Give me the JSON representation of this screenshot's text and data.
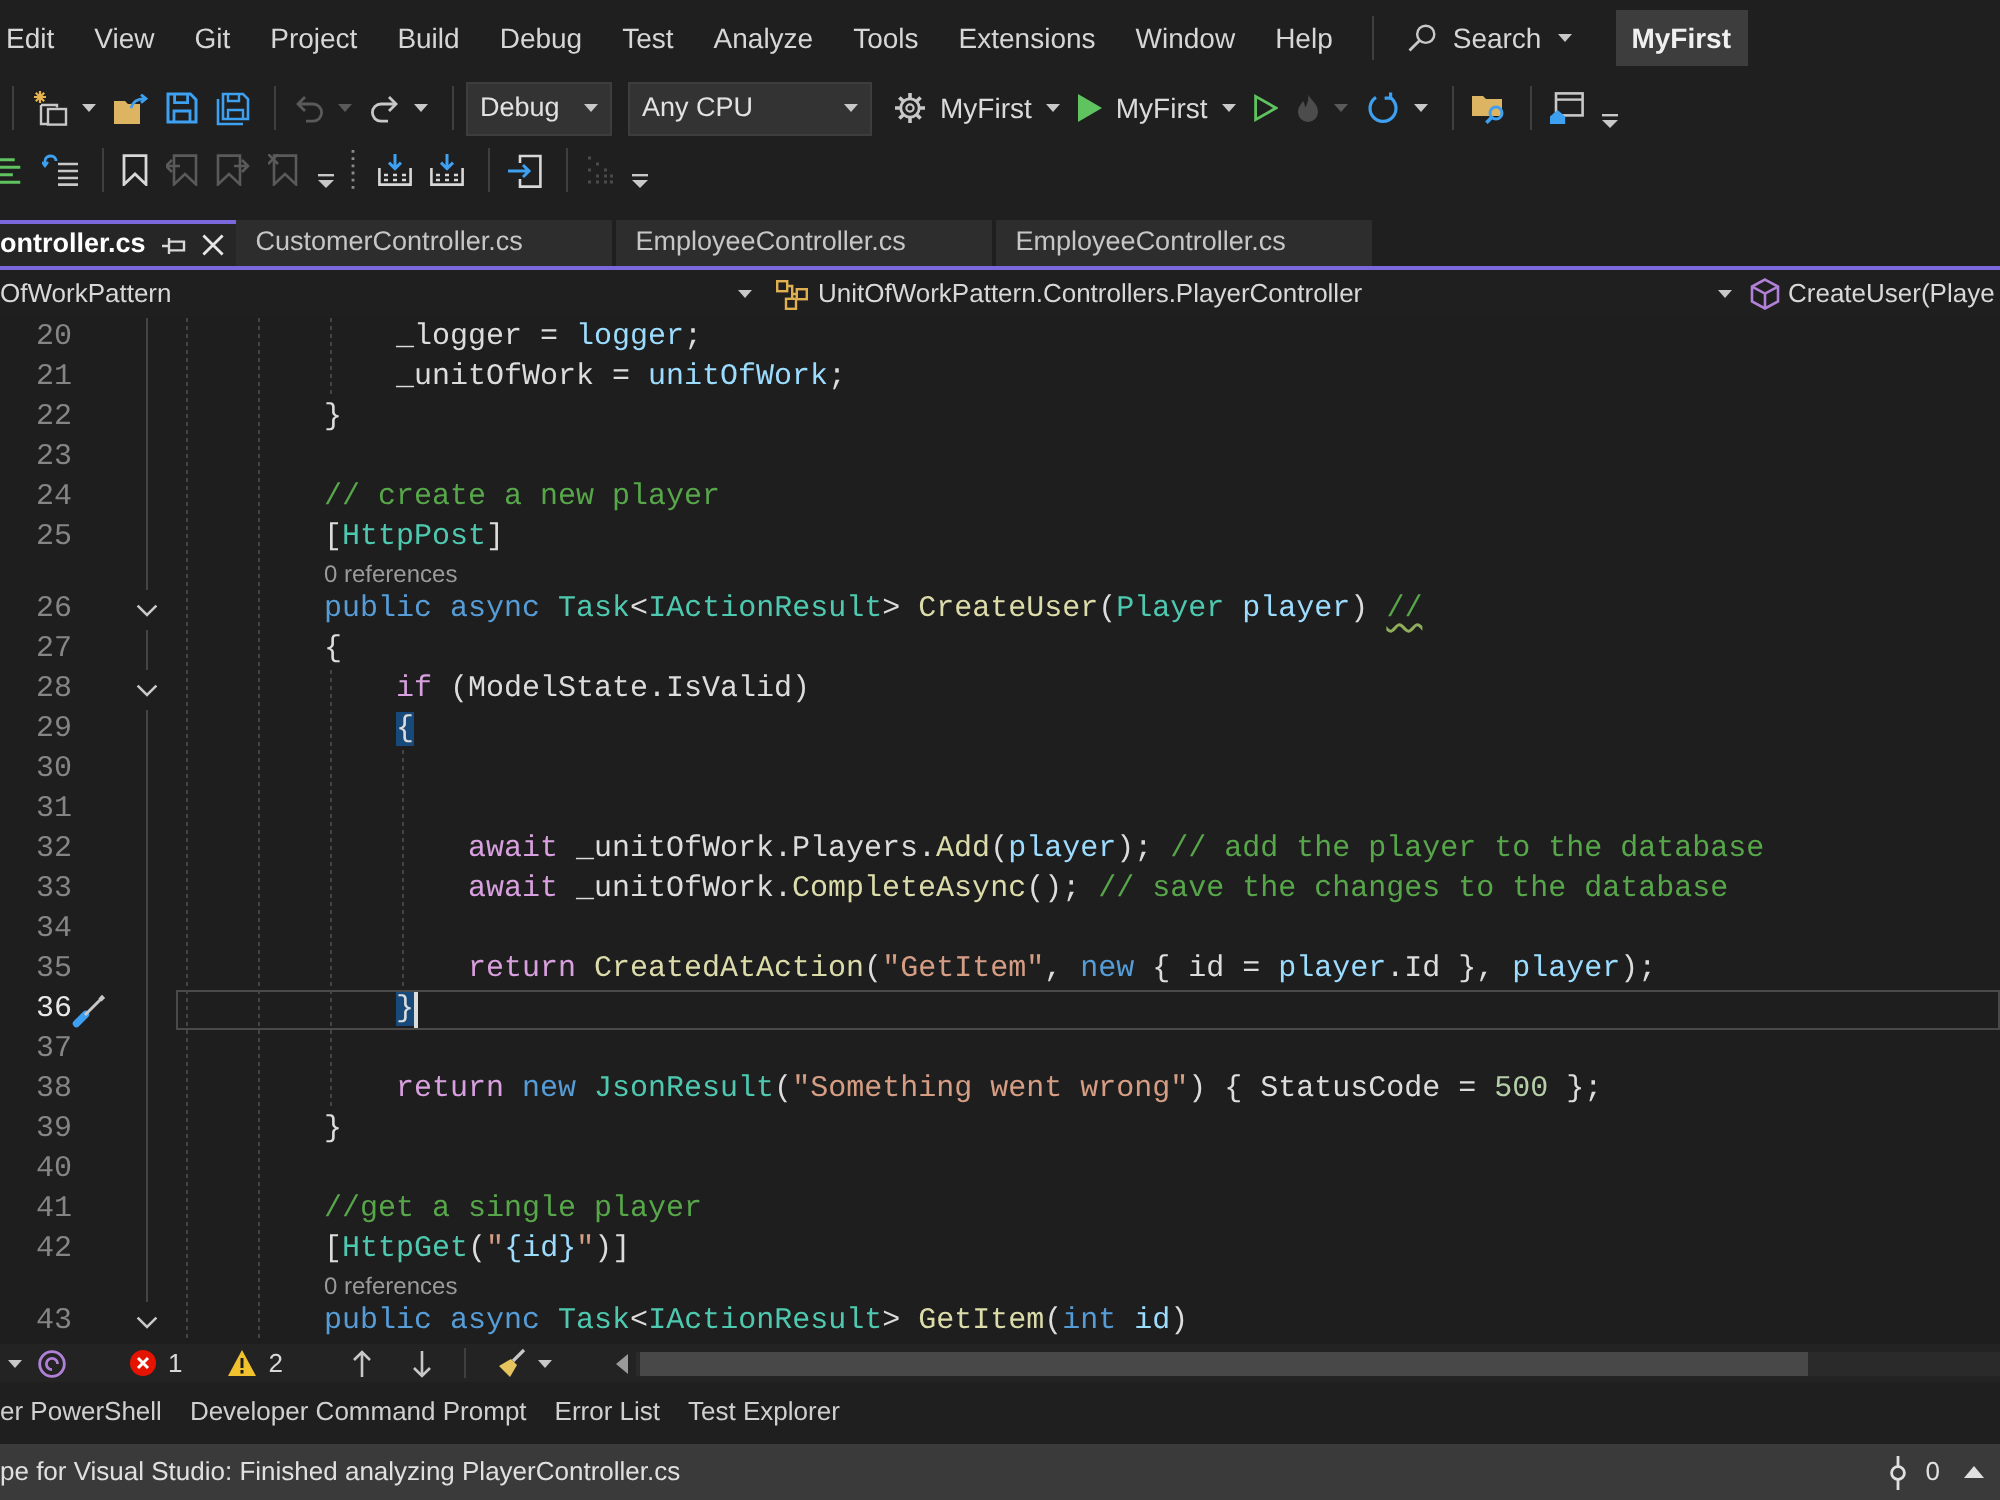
{
  "menu_bar": {
    "items": [
      "Edit",
      "View",
      "Git",
      "Project",
      "Build",
      "Debug",
      "Test",
      "Analyze",
      "Tools",
      "Extensions",
      "Window",
      "Help"
    ],
    "search": "Search",
    "solution": "MyFirst"
  },
  "toolbar": [
    {
      "kind": "separator"
    },
    {
      "kind": "new",
      "disabled": false,
      "menu": true
    },
    {
      "kind": "open",
      "disabled": false
    },
    {
      "kind": "save",
      "disabled": false
    },
    {
      "kind": "saveall",
      "disabled": false
    },
    {
      "kind": "separator"
    },
    {
      "kind": "undo",
      "disabled": true,
      "menu": true
    },
    {
      "kind": "redo",
      "disabled": false,
      "menu": true
    },
    {
      "kind": "separator"
    },
    {
      "kind": "combo",
      "label": "Debug"
    },
    {
      "kind": "combo",
      "label": "Any CPU"
    },
    {
      "kind": "startup",
      "label": "MyFirst",
      "disabled": false,
      "menu": true
    },
    {
      "kind": "start",
      "label": "MyFirst",
      "disabled": false,
      "menu": true
    },
    {
      "kind": "start-plain",
      "disabled": false
    },
    {
      "kind": "hotreload",
      "disabled": true,
      "menu": true
    },
    {
      "kind": "restart",
      "disabled": false,
      "menu": true
    },
    {
      "kind": "separator"
    },
    {
      "kind": "folder-search",
      "disabled": false
    },
    {
      "kind": "separator"
    },
    {
      "kind": "browser",
      "disabled": false
    },
    {
      "kind": "overflow",
      "disabled": false
    }
  ],
  "toolbar_2": [
    {
      "kind": "comment",
      "disabled": false
    },
    {
      "kind": "uncomment",
      "disabled": false
    },
    {
      "kind": "separator"
    },
    {
      "kind": "bookmark",
      "disabled": false
    },
    {
      "kind": "bookmark-prev",
      "disabled": true
    },
    {
      "kind": "bookmark-next",
      "disabled": true
    },
    {
      "kind": "bookmark-clear",
      "disabled": true
    },
    {
      "kind": "overflow",
      "disabled": false
    },
    {
      "kind": "grip"
    },
    {
      "kind": "tray",
      "disabled": false
    },
    {
      "kind": "tray",
      "disabled": false
    },
    {
      "kind": "separator"
    },
    {
      "kind": "step",
      "disabled": false
    },
    {
      "kind": "separator"
    },
    {
      "kind": "dots",
      "disabled": true
    },
    {
      "kind": "overflow",
      "disabled": false
    }
  ],
  "tabs": [
    {
      "label": "ontroller.cs",
      "selected": true
    },
    {
      "label": "CustomerController.cs",
      "selected": false
    },
    {
      "label": "EmployeeController.cs",
      "selected": false
    },
    {
      "label": "EmployeeController.cs",
      "selected": false
    }
  ],
  "navigation_bar": [
    {
      "kind": "project",
      "label": "OfWorkPattern"
    },
    {
      "kind": "type",
      "label": "UnitOfWorkPattern.Controllers.PlayerController"
    },
    {
      "kind": "member",
      "label": "CreateUser(Playe"
    }
  ],
  "editor": {
    "lines": [
      {
        "kind": "code",
        "number": "20",
        "tokens": [
          {
            "kind": "plain",
            "text": "            _logger = "
          },
          {
            "kind": "variable",
            "text": "logger"
          },
          {
            "kind": "plain",
            "text": ";"
          }
        ]
      },
      {
        "kind": "code",
        "number": "21",
        "tokens": [
          {
            "kind": "plain",
            "text": "            _unitOfWork = "
          },
          {
            "kind": "variable",
            "text": "unitOfWork"
          },
          {
            "kind": "plain",
            "text": ";"
          }
        ]
      },
      {
        "kind": "code",
        "number": "22",
        "tokens": [
          {
            "kind": "plain",
            "text": "        }"
          }
        ]
      },
      {
        "kind": "code",
        "number": "23"
      },
      {
        "kind": "code",
        "number": "24",
        "tokens": [
          {
            "kind": "comment",
            "text": "        // create a new player"
          }
        ]
      },
      {
        "kind": "code",
        "number": "25",
        "tokens": [
          {
            "kind": "plain",
            "text": "        ["
          },
          {
            "kind": "type",
            "text": "HttpPost"
          },
          {
            "kind": "plain",
            "text": "]"
          }
        ]
      },
      {
        "kind": "codelens",
        "text": "0 references"
      },
      {
        "kind": "code",
        "number": "26",
        "expanded": true,
        "tokens": [
          {
            "kind": "keyword",
            "text": "        public async "
          },
          {
            "kind": "type",
            "text": "Task"
          },
          {
            "kind": "plain",
            "text": "<"
          },
          {
            "kind": "type",
            "text": "IActionResult"
          },
          {
            "kind": "plain",
            "text": "> "
          },
          {
            "kind": "method",
            "text": "CreateUser"
          },
          {
            "kind": "plain",
            "text": "("
          },
          {
            "kind": "type",
            "text": "Player "
          },
          {
            "kind": "variable",
            "text": "player"
          },
          {
            "kind": "plain",
            "text": ") "
          },
          {
            "kind": "comment",
            "text": "//",
            "squiggle": true
          }
        ]
      },
      {
        "kind": "code",
        "number": "27",
        "tokens": [
          {
            "kind": "plain",
            "text": "        {"
          }
        ]
      },
      {
        "kind": "code",
        "number": "28",
        "expanded": true,
        "tokens": [
          {
            "kind": "control",
            "text": "            if"
          },
          {
            "kind": "plain",
            "text": " (ModelState.IsValid)"
          }
        ]
      },
      {
        "kind": "code",
        "number": "29",
        "tokens": [
          {
            "kind": "plain",
            "text": "            {",
            "highlight": true
          }
        ]
      },
      {
        "kind": "code",
        "number": "30"
      },
      {
        "kind": "code",
        "number": "31"
      },
      {
        "kind": "code",
        "number": "32",
        "tokens": [
          {
            "kind": "control",
            "text": "                await"
          },
          {
            "kind": "plain",
            "text": " _unitOfWork.Players."
          },
          {
            "kind": "method",
            "text": "Add"
          },
          {
            "kind": "plain",
            "text": "("
          },
          {
            "kind": "variable",
            "text": "player"
          },
          {
            "kind": "plain",
            "text": "); "
          },
          {
            "kind": "comment",
            "text": "// add the player to the database"
          }
        ]
      },
      {
        "kind": "code",
        "number": "33",
        "tokens": [
          {
            "kind": "control",
            "text": "                await"
          },
          {
            "kind": "plain",
            "text": " _unitOfWork."
          },
          {
            "kind": "method",
            "text": "CompleteAsync"
          },
          {
            "kind": "plain",
            "text": "(); "
          },
          {
            "kind": "comment",
            "text": "// save the changes to the database"
          }
        ]
      },
      {
        "kind": "code",
        "number": "34"
      },
      {
        "kind": "code",
        "number": "35",
        "tokens": [
          {
            "kind": "control",
            "text": "                return "
          },
          {
            "kind": "method",
            "text": "CreatedAtAction"
          },
          {
            "kind": "plain",
            "text": "("
          },
          {
            "kind": "string",
            "text": "\"GetItem\""
          },
          {
            "kind": "plain",
            "text": ", "
          },
          {
            "kind": "keyword",
            "text": "new"
          },
          {
            "kind": "plain",
            "text": " { id = "
          },
          {
            "kind": "variable",
            "text": "player"
          },
          {
            "kind": "plain",
            "text": ".Id }, "
          },
          {
            "kind": "variable",
            "text": "player"
          },
          {
            "kind": "plain",
            "text": ");"
          }
        ]
      },
      {
        "kind": "code",
        "number": "36",
        "current": true,
        "quick_action": true,
        "tokens": [
          {
            "kind": "plain",
            "text": "            }",
            "highlight": true,
            "caret": true
          }
        ]
      },
      {
        "kind": "code",
        "number": "37"
      },
      {
        "kind": "code",
        "number": "38",
        "tokens": [
          {
            "kind": "control",
            "text": "            return "
          },
          {
            "kind": "keyword",
            "text": "new "
          },
          {
            "kind": "type",
            "text": "JsonResult"
          },
          {
            "kind": "plain",
            "text": "("
          },
          {
            "kind": "string",
            "text": "\"Something went wrong\""
          },
          {
            "kind": "plain",
            "text": ") { StatusCode = "
          },
          {
            "kind": "number",
            "text": "500"
          },
          {
            "kind": "plain",
            "text": " };"
          }
        ]
      },
      {
        "kind": "code",
        "number": "39",
        "tokens": [
          {
            "kind": "plain",
            "text": "        }"
          }
        ]
      },
      {
        "kind": "code",
        "number": "40"
      },
      {
        "kind": "code",
        "number": "41",
        "tokens": [
          {
            "kind": "comment",
            "text": "        //get a single player"
          }
        ]
      },
      {
        "kind": "code",
        "number": "42",
        "tokens": [
          {
            "kind": "plain",
            "text": "        ["
          },
          {
            "kind": "type",
            "text": "HttpGet"
          },
          {
            "kind": "plain",
            "text": "("
          },
          {
            "kind": "string",
            "text": "\""
          },
          {
            "kind": "variable",
            "text": "{id}"
          },
          {
            "kind": "string",
            "text": "\""
          },
          {
            "kind": "plain",
            "text": ")]"
          }
        ]
      },
      {
        "kind": "codelens",
        "text": "0 references"
      },
      {
        "kind": "code",
        "number": "43",
        "expanded": true,
        "tokens": [
          {
            "kind": "keyword",
            "text": "        public async "
          },
          {
            "kind": "type",
            "text": "Task"
          },
          {
            "kind": "plain",
            "text": "<"
          },
          {
            "kind": "type",
            "text": "IActionResult"
          },
          {
            "kind": "plain",
            "text": "> "
          },
          {
            "kind": "method",
            "text": "GetItem"
          },
          {
            "kind": "plain",
            "text": "("
          },
          {
            "kind": "keyword",
            "text": "int "
          },
          {
            "kind": "variable",
            "text": "id"
          },
          {
            "kind": "plain",
            "text": ")"
          }
        ]
      }
    ]
  },
  "editor_status": {
    "errors": "1",
    "warnings": "2"
  },
  "tool_tabs": [
    {
      "label": "er PowerShell",
      "selected": false
    },
    {
      "label": "Developer Command Prompt",
      "selected": false
    },
    {
      "label": "Error List",
      "selected": false
    },
    {
      "label": "Test Explorer",
      "selected": false
    }
  ],
  "status_bar": {
    "message": "pe for Visual Studio: Finished analyzing PlayerController.cs",
    "count": "0"
  }
}
